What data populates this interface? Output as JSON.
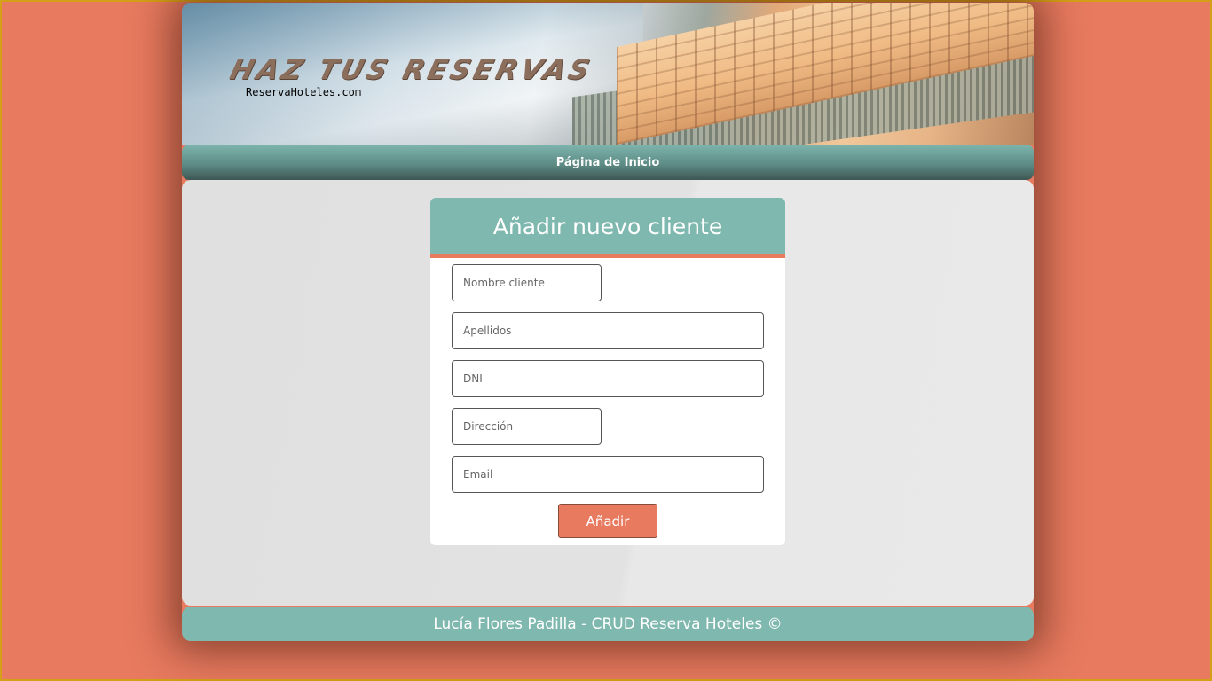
{
  "banner": {
    "title": "HAZ TUS RESERVAS",
    "subtitle": "ReservaHoteles.com"
  },
  "nav": {
    "home_label": "Página de Inicio"
  },
  "form": {
    "title": "Añadir nuevo cliente",
    "fields": [
      {
        "placeholder": "Nombre cliente",
        "value": ""
      },
      {
        "placeholder": "Apellidos",
        "value": ""
      },
      {
        "placeholder": "DNI",
        "value": ""
      },
      {
        "placeholder": "Dirección",
        "value": ""
      },
      {
        "placeholder": "Email",
        "value": ""
      }
    ],
    "submit_label": "Añadir"
  },
  "footer": {
    "text": "Lucía Flores Padilla - CRUD Reserva Hoteles ©"
  },
  "colors": {
    "background": "#e77a5f",
    "accent_teal": "#7fb8ae",
    "accent_coral": "#e77a5f",
    "page_border": "#d4a017"
  }
}
